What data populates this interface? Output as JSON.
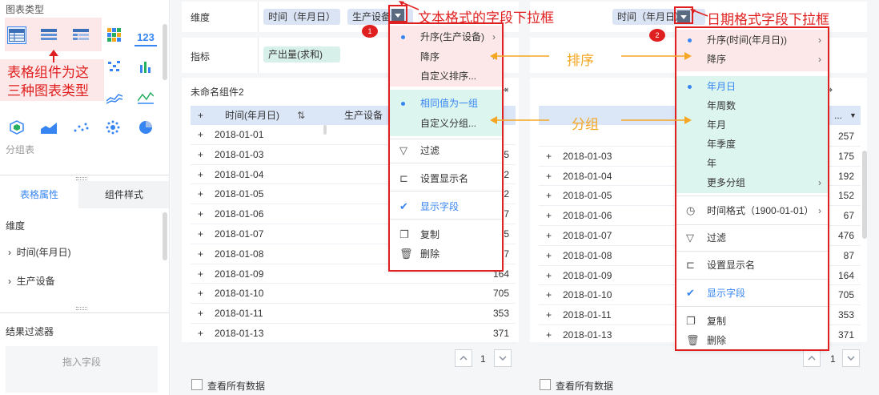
{
  "left": {
    "section_title": "图表类型",
    "annotation": "表格组件为这三种图表类型",
    "annotation_line1": "表格组件为这",
    "annotation_line2": "三种图表类型",
    "chart_type_label": "分组表",
    "chart_numeric_icon": "123",
    "tabs": [
      "表格属性",
      "组件样式"
    ],
    "dimension_label": "维度",
    "dimension_items": [
      "时间(年月日)",
      "生产设备"
    ],
    "filter_label": "结果过滤器",
    "drop_hint": "拖入字段"
  },
  "toolbar": {
    "dimension_label": "维度",
    "dim_pill_date": "时间（年月日）",
    "dim_pill_device": "生产设备",
    "metric_label": "指标",
    "metric_pill": "产出量(求和)",
    "right_date_pill": "时间（年月日）"
  },
  "left_table": {
    "title": "未命名组件2",
    "headers": [
      "时间(年月日)",
      "生产设备"
    ],
    "rows": [
      {
        "date": "2018-01-01",
        "value": ""
      },
      {
        "date": "2018-01-03",
        "value": "5"
      },
      {
        "date": "2018-01-04",
        "value": "2"
      },
      {
        "date": "2018-01-05",
        "value": "2"
      },
      {
        "date": "2018-01-06",
        "value": "7"
      },
      {
        "date": "2018-01-07",
        "value": "5"
      },
      {
        "date": "2018-01-08",
        "value": "7"
      },
      {
        "date": "2018-01-09",
        "value": "164"
      },
      {
        "date": "2018-01-10",
        "value": "705"
      },
      {
        "date": "2018-01-11",
        "value": "353"
      },
      {
        "date": "2018-01-13",
        "value": "371"
      }
    ],
    "page": "1",
    "view_all": "查看所有数据"
  },
  "right_table": {
    "header_dots": "...",
    "rows": [
      {
        "date": "",
        "value": "257"
      },
      {
        "date": "2018-01-03",
        "value": "175"
      },
      {
        "date": "2018-01-04",
        "value": "192"
      },
      {
        "date": "2018-01-05",
        "value": "152"
      },
      {
        "date": "2018-01-06",
        "value": "67"
      },
      {
        "date": "2018-01-07",
        "value": "476"
      },
      {
        "date": "2018-01-08",
        "value": "87"
      },
      {
        "date": "2018-01-09",
        "value": "164"
      },
      {
        "date": "2018-01-10",
        "value": "705"
      },
      {
        "date": "2018-01-11",
        "value": "353"
      },
      {
        "date": "2018-01-13",
        "value": "371"
      }
    ],
    "page": "1",
    "view_all": "查看所有数据"
  },
  "menu1": {
    "asc": "升序(生产设备)",
    "desc": "降序",
    "custom_sort": "自定义排序...",
    "same_group": "相同值为一组",
    "custom_group": "自定义分组...",
    "filter": "过滤",
    "display_name": "设置显示名",
    "show_field": "显示字段",
    "copy": "复制",
    "delete": "删除"
  },
  "menu2": {
    "asc": "升序(时间(年月日))",
    "desc": "降序",
    "ymd": "年月日",
    "yw": "年周数",
    "ym": "年月",
    "yq": "年季度",
    "y": "年",
    "more_group": "更多分组",
    "time_format": "时间格式（1900-01-01）",
    "filter": "过滤",
    "display_name": "设置显示名",
    "show_field": "显示字段",
    "copy": "复制",
    "delete": "删除"
  },
  "annotations": {
    "text_dropdown": "文本格式的字段下拉框",
    "date_dropdown": "日期格式字段下拉框",
    "sort": "排序",
    "group": "分组",
    "badge1": "1",
    "badge2": "2"
  },
  "colors": {
    "accent": "#3685f2",
    "annotation_red": "#e02020",
    "arrow_orange": "#f5a623",
    "pink_zone": "#fce8e8",
    "teal_zone": "#ddf5ef"
  }
}
